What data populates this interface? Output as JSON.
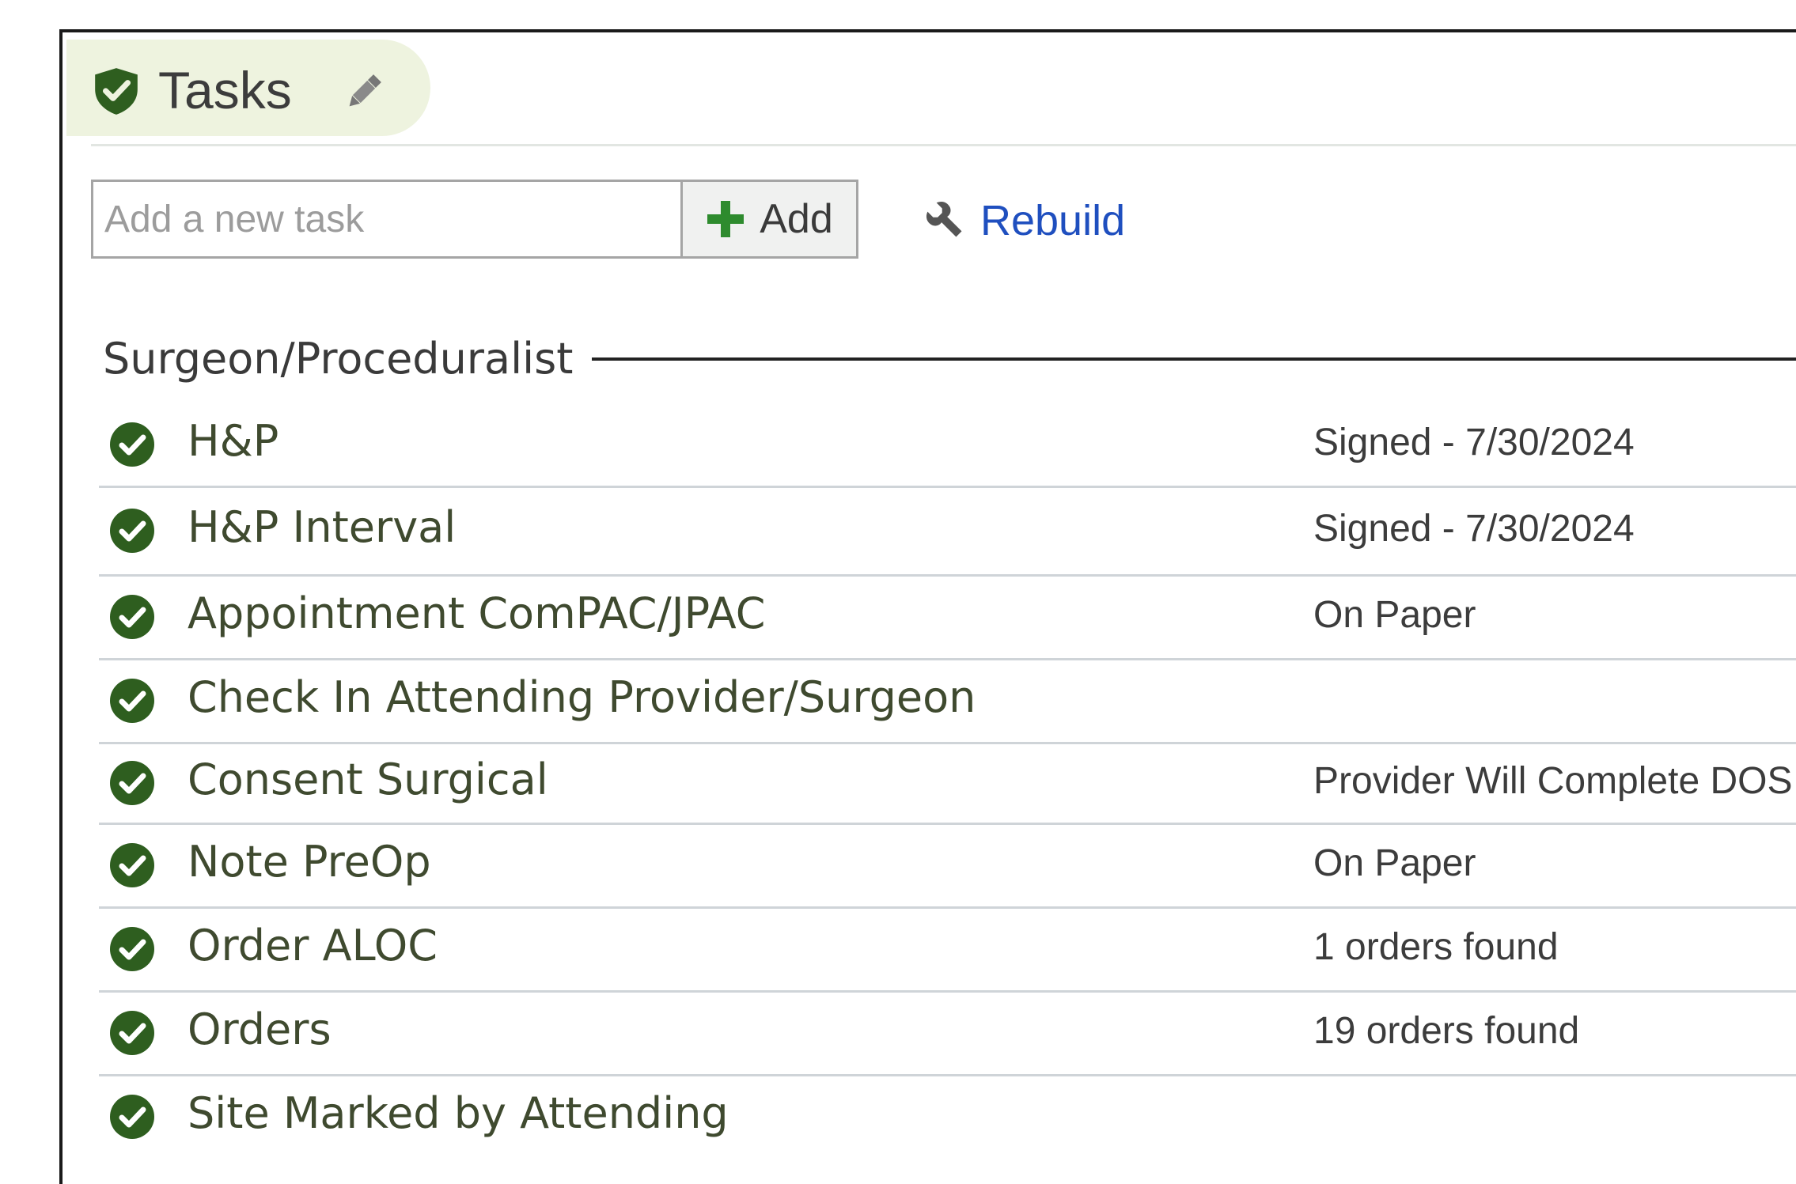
{
  "header": {
    "title": "Tasks",
    "shield_icon": "shield-check-icon",
    "edit_icon": "pencil-icon",
    "tab_color": "#eef3df",
    "icon_color": "#2e5e1f"
  },
  "add_task": {
    "placeholder": "Add a new task",
    "value": "",
    "add_label": "Add",
    "add_icon": "plus-icon",
    "add_icon_color": "#2e8b2e"
  },
  "rebuild": {
    "label": "Rebuild",
    "icon": "wrench-icon",
    "color": "#1f4fbf"
  },
  "section": {
    "title": "Surgeon/Proceduralist"
  },
  "tasks": [
    {
      "name": "H&P",
      "status": "Signed - 7/30/2024",
      "completed": true
    },
    {
      "name": "H&P Interval",
      "status": "Signed - 7/30/2024",
      "completed": true
    },
    {
      "name": "Appointment ComPAC/JPAC",
      "status": "On Paper",
      "completed": true
    },
    {
      "name": "Check In Attending Provider/Surgeon",
      "status": "",
      "completed": true
    },
    {
      "name": "Consent Surgical",
      "status": "Provider Will Complete DOS",
      "completed": true
    },
    {
      "name": "Note PreOp",
      "status": "On Paper",
      "completed": true
    },
    {
      "name": "Order ALOC",
      "status": "1 orders found",
      "completed": true
    },
    {
      "name": "Orders",
      "status": "19 orders found",
      "completed": true
    },
    {
      "name": "Site Marked by Attending",
      "status": "",
      "completed": true
    }
  ],
  "colors": {
    "check_icon": "#2e5e1f",
    "task_text": "#3f4a2f",
    "row_divider": "#cfd4d8"
  }
}
